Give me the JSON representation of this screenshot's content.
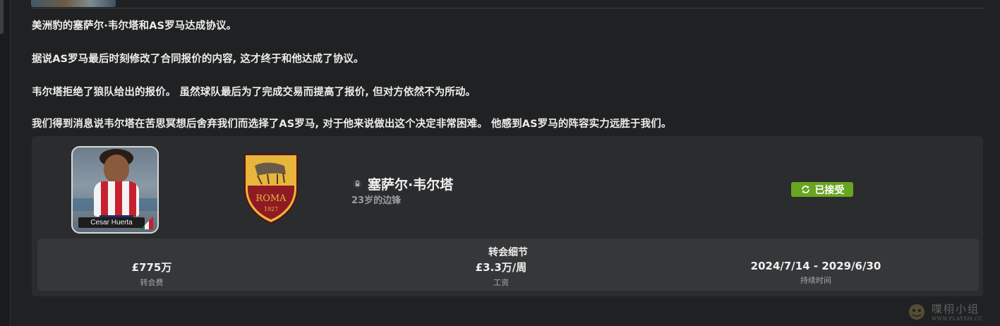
{
  "news": {
    "paragraphs": [
      "美洲豹的塞萨尔·韦尔塔和AS罗马达成协议。",
      "据说AS罗马最后时刻修改了合同报价的内容, 这才终于和他达成了协议。",
      "韦尔塔拒绝了狼队给出的报价。 虽然球队最后为了完成交易而提高了报价, 但对方依然不为所动。",
      "我们得到消息说韦尔塔在苦思冥想后舍弃我们而选择了AS罗马, 对于他来说做出这个决定非常困难。 他感到AS罗马的阵容实力远胜于我们。"
    ]
  },
  "transfer_card": {
    "player_photo_caption": "Cesar Huerta",
    "club_crest_text": "ROMA",
    "club_crest_year": "1927",
    "player_name": "塞萨尔·韦尔塔",
    "player_description": "23岁的边锋",
    "status": "已接受",
    "status_color": "#6aa522",
    "details_title": "转会细节",
    "details": [
      {
        "value": "£775万",
        "label": "转会费"
      },
      {
        "value": "£3.3万/周",
        "label": "工资"
      },
      {
        "value": "2024/7/14 - 2029/6/30",
        "label": "持续时间"
      }
    ]
  },
  "watermark": {
    "main": "喋栩小组",
    "url": "WWW.PLAYSM.CC"
  },
  "icons": {
    "lock": "lock-icon",
    "status": "refresh-icon"
  }
}
